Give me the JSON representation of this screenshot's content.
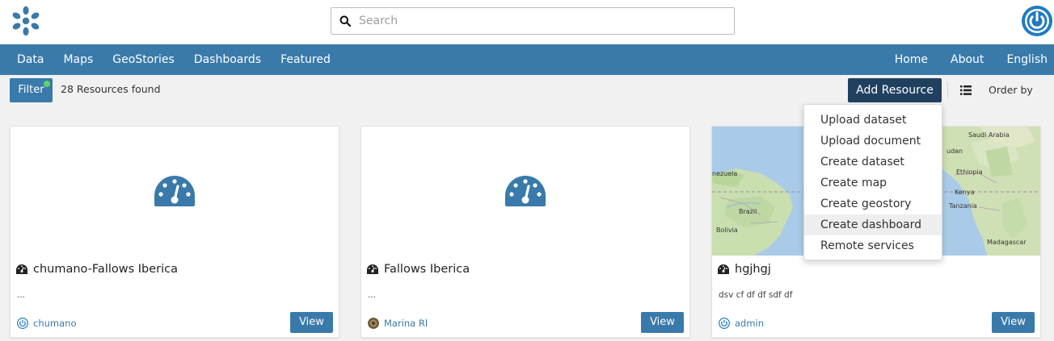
{
  "search": {
    "placeholder": "Search"
  },
  "nav": {
    "left": [
      "Data",
      "Maps",
      "GeoStories",
      "Dashboards",
      "Featured"
    ],
    "right": [
      "Home",
      "About",
      "English"
    ]
  },
  "toolbar": {
    "filter_label": "Filter",
    "results_count": "28 Resources found",
    "add_resource_label": "Add Resource",
    "order_by_label": "Order by"
  },
  "add_menu": {
    "items": [
      "Upload dataset",
      "Upload document",
      "Create dataset",
      "Create map",
      "Create geostory",
      "Create dashboard",
      "Remote services"
    ],
    "highlighted": "Create dashboard"
  },
  "cards": [
    {
      "title": "chumano-Fallows Iberica",
      "description": "...",
      "owner": "chumano",
      "view_label": "View",
      "type_icon": "dashboard-icon",
      "thumb_icon": "dashboard-icon"
    },
    {
      "title": "Fallows Iberica",
      "description": "...",
      "owner": "Marina Rl",
      "view_label": "View",
      "type_icon": "dashboard-icon",
      "thumb_icon": "dashboard-icon"
    },
    {
      "title": "hgjhgj",
      "description": "dsv cf df df sdf  df",
      "owner": "admin",
      "view_label": "View",
      "type_icon": "dashboard-icon",
      "thumb_icon": "map-thumbnail"
    }
  ],
  "map_labels": [
    "Saudi Arabia",
    "udan",
    "Ethiopia",
    "Kenya",
    "Tanzania",
    "Madagascar",
    "nezuela",
    "Brazil",
    "Bolivia"
  ],
  "colors": {
    "primary": "#397aab",
    "dark_button": "#204060",
    "filter_dot": "#5fd26b",
    "background": "#f2f1f1"
  }
}
